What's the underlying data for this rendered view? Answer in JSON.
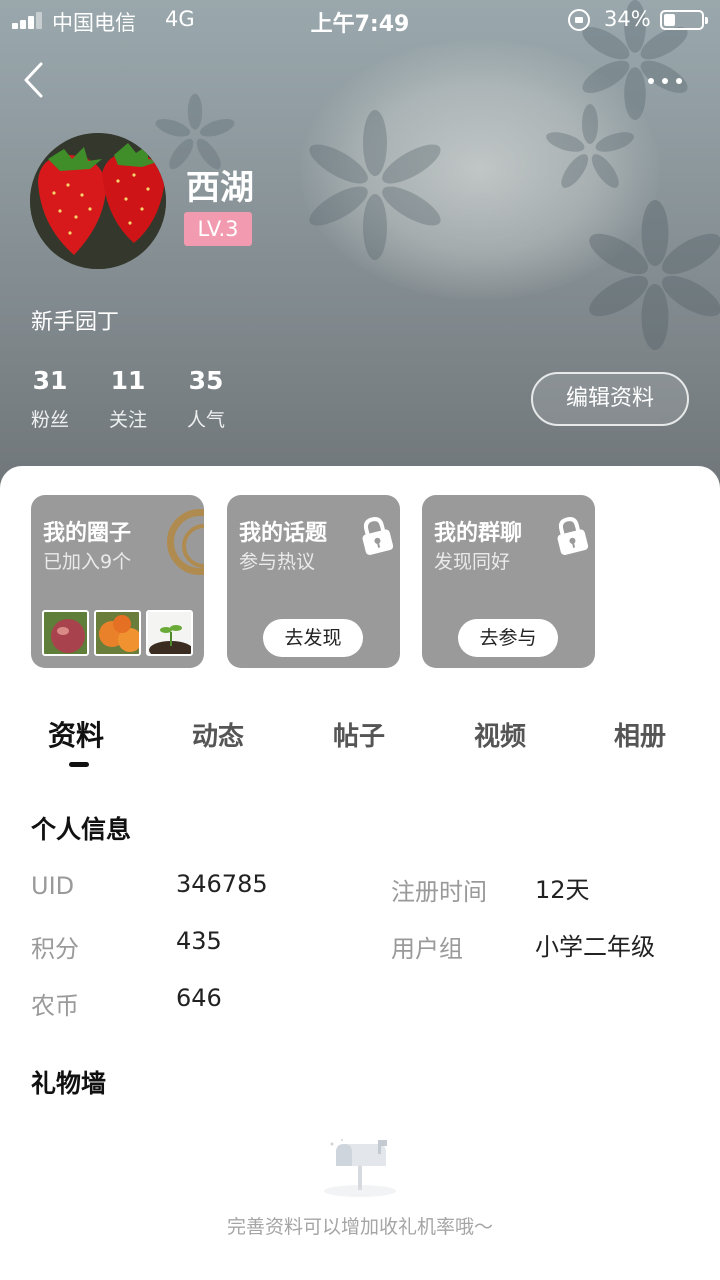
{
  "status_bar": {
    "carrier": "中国电信",
    "network": "4G",
    "time": "上午7:49",
    "battery_percent": "34%",
    "battery_level": 0.34
  },
  "nav": {
    "back_icon": "chevron-left-icon",
    "more_icon": "more-dots-icon"
  },
  "profile": {
    "name": "西湖",
    "level": "LV.3",
    "title": "新手园丁",
    "stats": [
      {
        "value": "31",
        "label": "粉丝"
      },
      {
        "value": "11",
        "label": "关注"
      },
      {
        "value": "35",
        "label": "人气"
      }
    ],
    "edit_label": "编辑资料",
    "level_color": "#f29bb0"
  },
  "cards": [
    {
      "title": "我的圈子",
      "subtitle": "已加入9个"
    },
    {
      "title": "我的话题",
      "subtitle": "参与热议",
      "button": "去发现"
    },
    {
      "title": "我的群聊",
      "subtitle": "发现同好",
      "button": "去参与"
    }
  ],
  "tabs": [
    {
      "label": "资料",
      "active": true
    },
    {
      "label": "动态"
    },
    {
      "label": "帖子"
    },
    {
      "label": "视频"
    },
    {
      "label": "相册"
    }
  ],
  "personal_info": {
    "title": "个人信息",
    "fields": [
      {
        "label": "UID",
        "value": "346785"
      },
      {
        "label": "注册时间",
        "value": "12天"
      },
      {
        "label": "积分",
        "value": "435"
      },
      {
        "label": "用户组",
        "value": "小学二年级"
      },
      {
        "label": "农币",
        "value": "646"
      }
    ]
  },
  "gift_wall": {
    "title": "礼物墙",
    "empty_text": "完善资料可以增加收礼机率哦～",
    "empty_icon": "mailbox-icon"
  }
}
